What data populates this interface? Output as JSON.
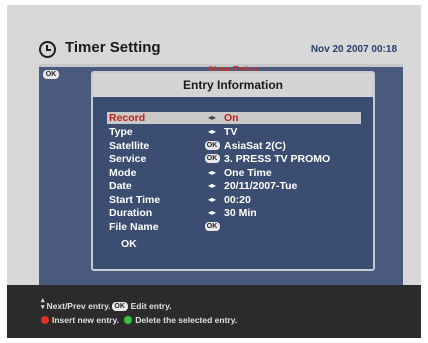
{
  "header": {
    "title": "Timer Setting",
    "datetime": "Nov 20 2007 00:18"
  },
  "list": {
    "ok_badge": "OK",
    "header_peek": "New Entry"
  },
  "dialog": {
    "title": "Entry Information",
    "rows": [
      {
        "label": "Record",
        "indicator": "◂▸",
        "value": "On"
      },
      {
        "label": "Type",
        "indicator": "◂▸",
        "value": "TV"
      },
      {
        "label": "Satellite",
        "indicator": "OK",
        "value": "AsiaSat 2(C)"
      },
      {
        "label": "Service",
        "indicator": "OK",
        "value": "3. PRESS TV PROMO"
      },
      {
        "label": "Mode",
        "indicator": "◂▸",
        "value": "One Time"
      },
      {
        "label": "Date",
        "indicator": "◂▸",
        "value": "20/11/2007-Tue"
      },
      {
        "label": "Start Time",
        "indicator": "◂▸",
        "value": "00:20"
      },
      {
        "label": "Duration",
        "indicator": "◂▸",
        "value": "30 Min"
      },
      {
        "label": "File Name",
        "indicator": "OK",
        "value": ""
      }
    ],
    "ok_button": "OK"
  },
  "footer": {
    "line1_nav": "Next/Prev entry.",
    "ok_badge": "OK",
    "line1_edit": "Edit entry.",
    "insert": "Insert new entry.",
    "delete": "Delete the selected entry.",
    "colors": {
      "red": "#e0302a",
      "green": "#3cc03c"
    }
  }
}
